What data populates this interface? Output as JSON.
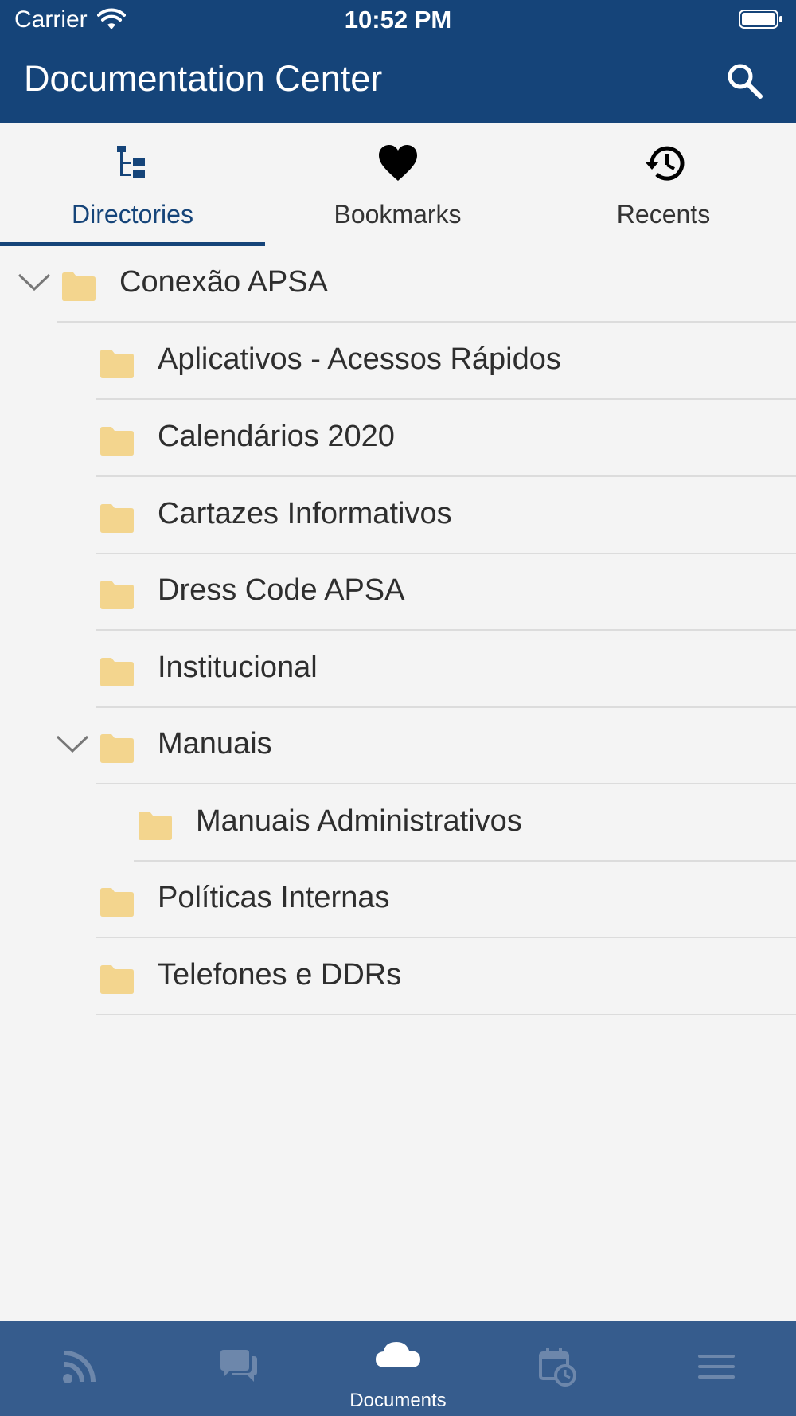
{
  "status_bar": {
    "carrier": "Carrier",
    "time": "10:52 PM"
  },
  "nav": {
    "title": "Documentation Center",
    "search_icon": "search-icon"
  },
  "tabs": [
    {
      "label": "Directories",
      "icon": "hierarchy-icon",
      "active": true
    },
    {
      "label": "Bookmarks",
      "icon": "heart-icon",
      "active": false
    },
    {
      "label": "Recents",
      "icon": "history-icon",
      "active": false
    }
  ],
  "tree": [
    {
      "label": "Conexão APSA",
      "level": 0,
      "expanded": true
    },
    {
      "label": "Aplicativos - Acessos Rápidos",
      "level": 1,
      "expanded": false
    },
    {
      "label": "Calendários 2020",
      "level": 1,
      "expanded": false
    },
    {
      "label": "Cartazes Informativos",
      "level": 1,
      "expanded": false
    },
    {
      "label": "Dress Code APSA",
      "level": 1,
      "expanded": false
    },
    {
      "label": "Institucional",
      "level": 1,
      "expanded": false
    },
    {
      "label": "Manuais",
      "level": 1,
      "expanded": true
    },
    {
      "label": "Manuais Administrativos",
      "level": 2,
      "expanded": false
    },
    {
      "label": "Políticas Internas",
      "level": 1,
      "expanded": false
    },
    {
      "label": "Telefones e DDRs",
      "level": 1,
      "expanded": false
    }
  ],
  "tabbar": [
    {
      "icon": "rss-icon",
      "label": "",
      "active": false
    },
    {
      "icon": "chat-icon",
      "label": "",
      "active": false
    },
    {
      "icon": "cloud-icon",
      "label": "Documents",
      "active": true
    },
    {
      "icon": "calendar-clock-icon",
      "label": "",
      "active": false
    },
    {
      "icon": "menu-icon",
      "label": "",
      "active": false
    }
  ],
  "colors": {
    "brand": "#154479",
    "tabbar": "#365c8d",
    "folder": "#f3d58e",
    "background": "#f4f4f4"
  }
}
